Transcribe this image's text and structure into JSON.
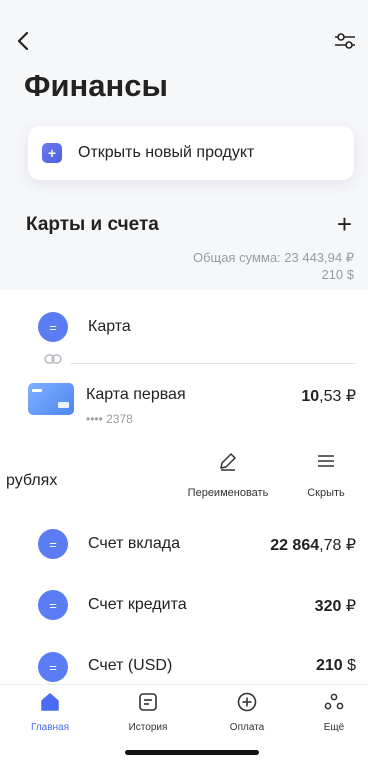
{
  "header": {
    "back_icon": "chevron-left-icon",
    "filter_icon": "sliders-icon",
    "title": "Финансы"
  },
  "new_product": {
    "label": "Открыть новый продукт",
    "icon": "plus-square-icon",
    "icon_glyph": "+",
    "accent": "#5566e8"
  },
  "accounts": {
    "title": "Карты и счета",
    "add_glyph": "+",
    "total_line1": "Общая сумма: 23 443,94 ₽",
    "total_line2": "210 $",
    "card_group": {
      "label": "Карта",
      "icon_glyph": "="
    },
    "card": {
      "name": "Карта первая",
      "number": "•••• 2378",
      "amount_int": "10",
      "amount_frac": ",53 ₽"
    },
    "swipe_actions": {
      "currency_label": "рублях",
      "rename_label": "Переименовать",
      "hide_label": "Скрыть"
    },
    "rows": [
      {
        "label": "Счет вклада",
        "amount_int": "22 864",
        "amount_frac": ",78 ₽"
      },
      {
        "label": "Счет кредита",
        "amount_int": "320",
        "amount_frac": " ₽"
      },
      {
        "label": "Счет (USD)",
        "amount_int": "210",
        "amount_frac": " $"
      }
    ]
  },
  "tabbar": {
    "tabs": [
      {
        "label": "Главная",
        "icon": "home-icon",
        "active": true
      },
      {
        "label": "История",
        "icon": "history-icon",
        "active": false
      },
      {
        "label": "Оплата",
        "icon": "plus-circle-icon",
        "active": false
      },
      {
        "label": "Ещё",
        "icon": "more-icon",
        "active": false
      }
    ]
  },
  "colors": {
    "accent": "#5b7cf3",
    "active_tab": "#4b6cf0",
    "muted_text": "#9a9ca3"
  }
}
